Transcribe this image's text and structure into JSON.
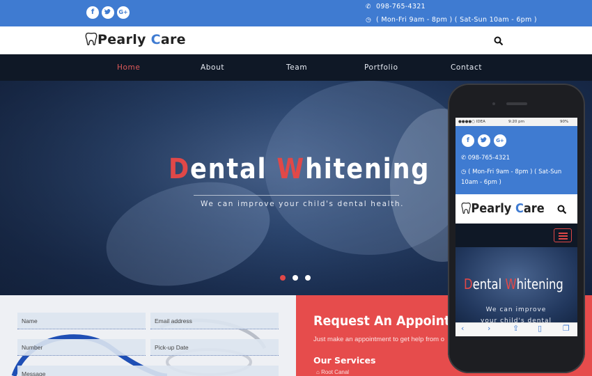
{
  "topbar": {
    "social": [
      {
        "icon": "facebook-icon",
        "glyph": "f"
      },
      {
        "icon": "twitter-icon",
        "glyph": "🐦"
      },
      {
        "icon": "google-plus-icon",
        "glyph": "G+"
      }
    ],
    "phone": "098-765-4321",
    "hours": "( Mon-Fri 9am - 8pm ) ( Sat-Sun 10am - 6pm )"
  },
  "logo": {
    "pre": "earl",
    "p": "P",
    "y": "y ",
    "c": "C",
    "post": "are"
  },
  "nav": {
    "items": [
      "Home",
      "About",
      "Team",
      "Portfolio",
      "Contact"
    ],
    "active": "Home"
  },
  "hero": {
    "title_d": "D",
    "title_mid": "ental ",
    "title_w": "W",
    "title_end": "hitening",
    "subtitle": "We can improve your child's dental health.",
    "slides": 3,
    "active_slide": 1
  },
  "form": {
    "name_placeholder": "Name",
    "email_placeholder": "Email address",
    "number_placeholder": "Number",
    "date_placeholder": "Pick-up Date",
    "message_placeholder": "Message"
  },
  "appointment": {
    "title": "Request An Appointment",
    "text": "Just make an appointment to get help from o",
    "services_title": "Our Services",
    "services": [
      "Root Canal"
    ]
  },
  "phone_preview": {
    "status_carrier": "●●●●○ IDEA",
    "status_time": "9:20 pm",
    "status_battery": "90%",
    "phone": "098-765-4321",
    "hours": "( Mon-Fri 9am - 8pm ) ( Sat-Sun 10am - 6pm )",
    "hero_d": "D",
    "hero_mid": "ental ",
    "hero_w": "W",
    "hero_end": "hitening",
    "hero_sub": "We can improve your child's dental health."
  },
  "colors": {
    "brand_blue": "#3f7bd1",
    "accent_red": "#e04848",
    "nav_dark": "#0f1826"
  }
}
